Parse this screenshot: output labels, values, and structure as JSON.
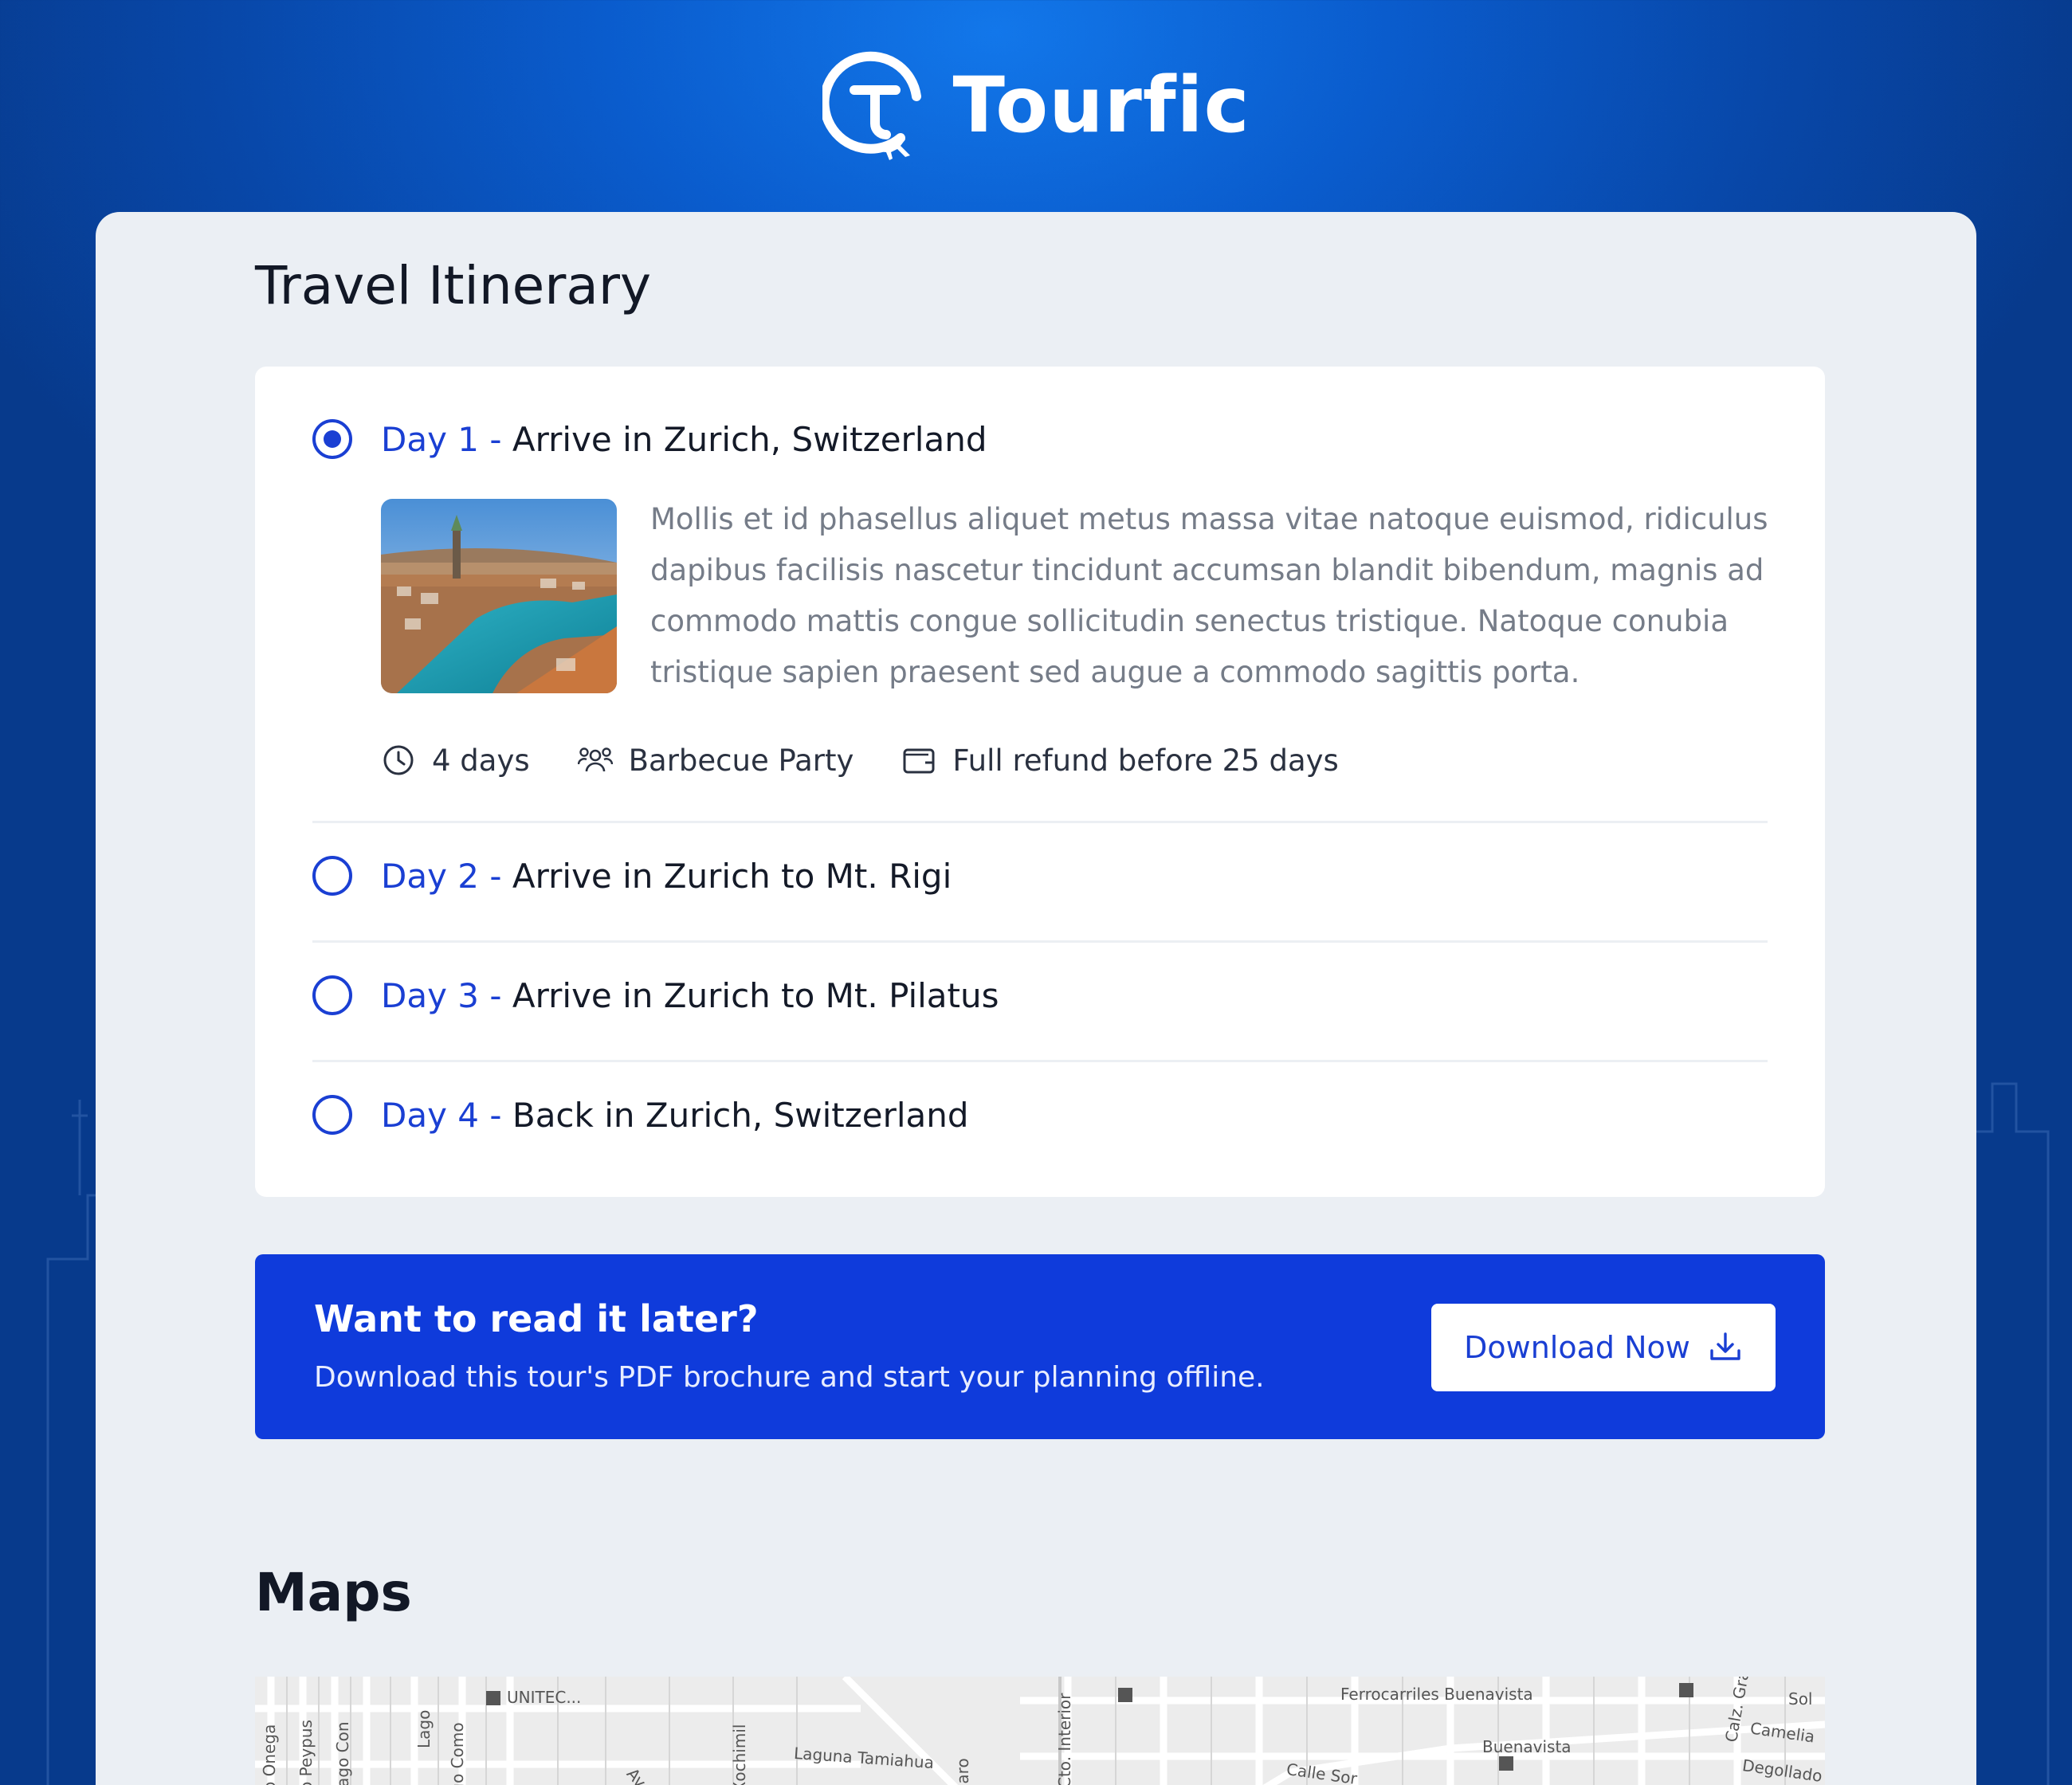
{
  "brand": {
    "name": "Tourfic",
    "logo_icon": "tourfic-logo-icon"
  },
  "colors": {
    "accent": "#1a3fd3",
    "cta_background": "#0f3bdb",
    "card_background": "#ebeff4",
    "header_gradient": "#0a5ccd"
  },
  "itinerary": {
    "title": "Travel Itinerary",
    "days": [
      {
        "num": "Day 1",
        "sep": " - ",
        "title": "Arrive in Zurich, Switzerland",
        "selected": true
      },
      {
        "num": "Day 2",
        "sep": " - ",
        "title": "Arrive in Zurich to Mt. Rigi",
        "selected": false
      },
      {
        "num": "Day 3",
        "sep": " - ",
        "title": "Arrive in Zurich to Mt. Pilatus",
        "selected": false
      },
      {
        "num": "Day 4",
        "sep": " - ",
        "title": "Back in Zurich, Switzerland",
        "selected": false
      }
    ],
    "expanded": {
      "description": "Mollis et id phasellus aliquet metus massa vitae natoque euismod, ridiculus dapibus facilisis nascetur tincidunt accumsan blandit bibendum, magnis ad commodo mattis congue sollicitudin senectus tristique. Natoque conubia tristique sapien praesent sed augue a commodo sagittis porta.",
      "image_icon": "zurich-city-photo",
      "meta": [
        {
          "icon": "clock-icon",
          "label": "4 days"
        },
        {
          "icon": "users-icon",
          "label": "Barbecue Party"
        },
        {
          "icon": "wallet-icon",
          "label": "Full refund before 25 days"
        }
      ]
    }
  },
  "cta": {
    "title": "Want to read it later?",
    "subtitle": "Download this tour's PDF brochure and start your planning offline.",
    "button_label": "Download Now",
    "button_icon": "download-icon"
  },
  "maps": {
    "title": "Maps",
    "labels": [
      "Lago Onega",
      "Lago Peypus",
      "Lago Con",
      "Lago",
      "Lago Como",
      "UNITEC...",
      "Av. M",
      "Lago Xochimil",
      "Laguna Tamiahua",
      "Patzcuaro",
      "Cto. Interior",
      "Ferrocarriles Buenavista",
      "Buenavista",
      "Calle Sor",
      "Calz. Gra",
      "Sol",
      "Camelia",
      "Degollado"
    ]
  }
}
